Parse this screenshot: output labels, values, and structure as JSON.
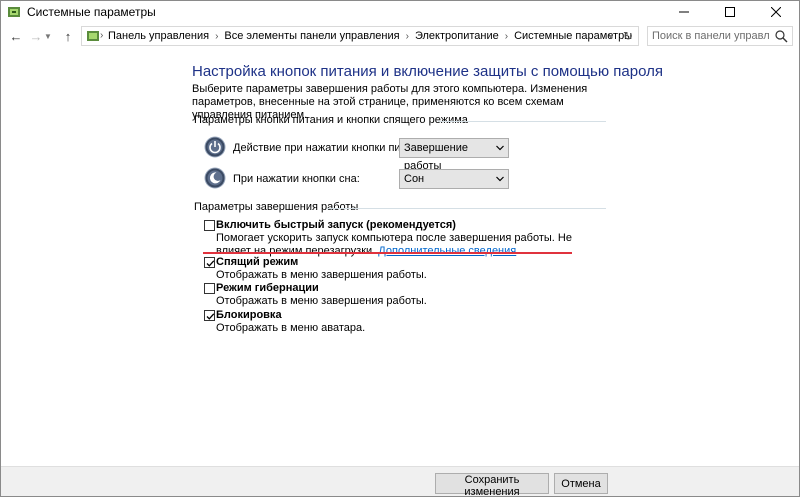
{
  "window": {
    "title": "Системные параметры"
  },
  "address": {
    "breadcrumbs": [
      "Панель управления",
      "Все элементы панели управления",
      "Электропитание",
      "Системные параметры"
    ]
  },
  "search": {
    "placeholder": "Поиск в панели управления"
  },
  "content": {
    "heading": "Настройка кнопок питания и включение защиты с помощью пароля",
    "description": "Выберите параметры завершения работы для этого компьютера. Изменения параметров, внесенные на этой странице, применяются ко всем схемам управления питанием.",
    "buttons_group": {
      "label": "Параметры кнопки питания и кнопки спящего режима",
      "power_label": "Действие при нажатии кнопки питания:",
      "power_value": "Завершение работы",
      "sleep_label": "При нажатии кнопки сна:",
      "sleep_value": "Сон"
    },
    "shutdown_group": {
      "label": "Параметры завершения работы",
      "options": [
        {
          "title": "Включить быстрый запуск (рекомендуется)",
          "desc": "Помогает ускорить запуск компьютера после завершения работы. Не влияет на режим перезагрузки.",
          "link": "Дополнительные сведения",
          "checked": false
        },
        {
          "title": "Спящий режим",
          "desc": "Отображать в меню завершения работы.",
          "checked": true
        },
        {
          "title": "Режим гибернации",
          "desc": "Отображать в меню завершения работы.",
          "checked": false
        },
        {
          "title": "Блокировка",
          "desc": "Отображать в меню аватара.",
          "checked": true
        }
      ]
    }
  },
  "footer": {
    "save_label": "Сохранить изменения",
    "cancel_label": "Отмена"
  },
  "colors": {
    "heading": "#1e3287",
    "link": "#0066cc",
    "highlight": "#e0323d"
  },
  "icons": [
    "app-icon",
    "minimize-icon",
    "maximize-icon",
    "close-icon",
    "back-arrow-icon",
    "forward-arrow-icon",
    "up-arrow-icon",
    "search-icon",
    "power-icon",
    "sleep-icon",
    "checkmark-icon"
  ]
}
